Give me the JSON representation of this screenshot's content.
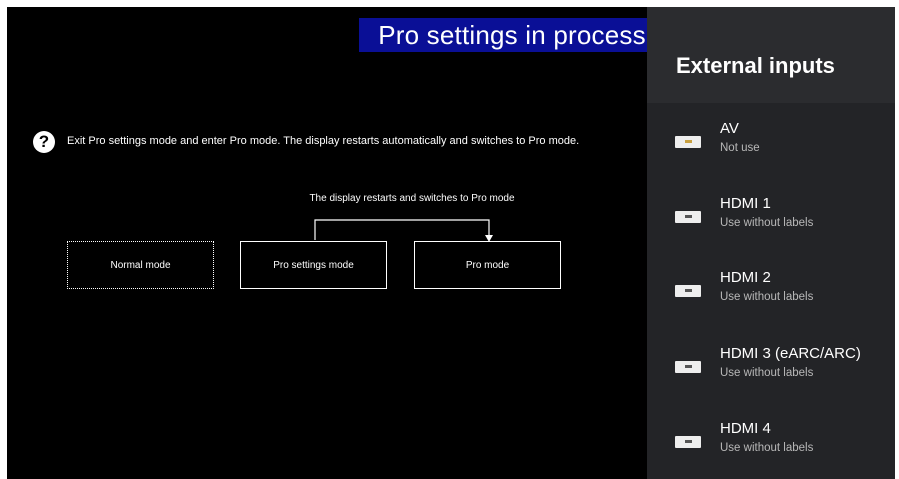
{
  "banner": {
    "text": "Pro settings in process"
  },
  "message": {
    "text": "Exit Pro settings mode and enter Pro mode. The display restarts automatically and switches to Pro mode."
  },
  "flow": {
    "caption": "The display restarts and switches to Pro mode",
    "modes": [
      "Normal mode",
      "Pro settings mode",
      "Pro mode"
    ]
  },
  "panel": {
    "title": "External inputs",
    "inputs": [
      {
        "name": "AV",
        "status": "Not use",
        "icon": "av-connector-icon"
      },
      {
        "name": "HDMI 1",
        "status": "Use without labels",
        "icon": "hdmi-connector-icon"
      },
      {
        "name": "HDMI 2",
        "status": "Use without labels",
        "icon": "hdmi-connector-icon"
      },
      {
        "name": "HDMI 3 (eARC/ARC)",
        "status": "Use without labels",
        "icon": "hdmi-connector-icon"
      },
      {
        "name": "HDMI 4",
        "status": "Use without labels",
        "icon": "hdmi-connector-icon"
      }
    ]
  }
}
